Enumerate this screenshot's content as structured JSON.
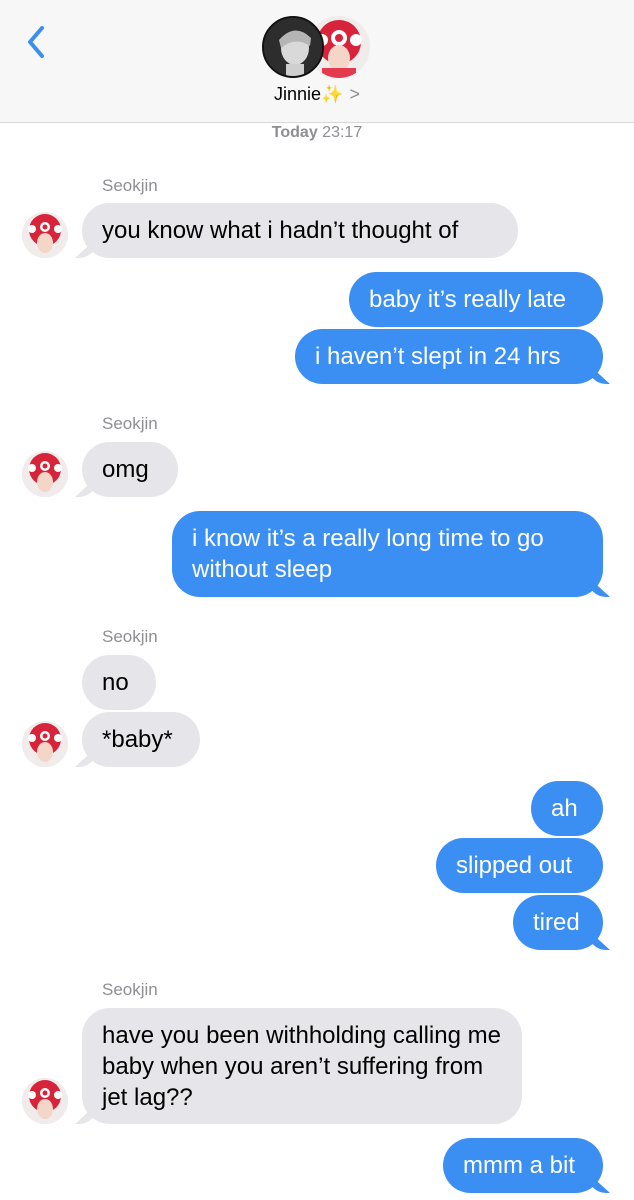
{
  "header": {
    "contact_name": "Jinnie✨",
    "chevron": ">",
    "back_icon": "chevron-left-icon",
    "accent": "#3b8ef2"
  },
  "timestamp": {
    "day": "Today",
    "time": "23:17"
  },
  "messages": [
    {
      "from": "Seokjin",
      "text": "you know what i hadn’t thought of"
    },
    {
      "from": "me",
      "text": "baby it’s really late"
    },
    {
      "from": "me",
      "text": "i haven’t slept in 24 hrs"
    },
    {
      "from": "Seokjin",
      "text": "omg"
    },
    {
      "from": "me",
      "text": "i know it’s a really long time to go without sleep"
    },
    {
      "from": "Seokjin",
      "text": "no"
    },
    {
      "from": "Seokjin",
      "text": "*baby*"
    },
    {
      "from": "me",
      "text": "ah"
    },
    {
      "from": "me",
      "text": "slipped out"
    },
    {
      "from": "me",
      "text": "tired"
    },
    {
      "from": "Seokjin",
      "text": "have you been withholding calling me baby when you aren’t suffering from jet lag??"
    },
    {
      "from": "me",
      "text": "mmm a bit"
    }
  ],
  "sender_label": "Seokjin",
  "colors": {
    "incoming_bubble": "#e5e5ea",
    "outgoing_bubble": "#3b8ef2",
    "header_bg": "#f7f7f7"
  }
}
